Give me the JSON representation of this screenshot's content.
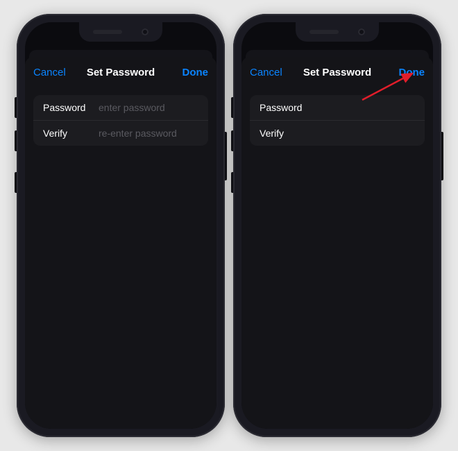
{
  "phones": {
    "left": {
      "nav": {
        "cancel": "Cancel",
        "title": "Set Password",
        "done": "Done"
      },
      "rows": {
        "password": {
          "label": "Password",
          "placeholder": "enter password",
          "value": ""
        },
        "verify": {
          "label": "Verify",
          "placeholder": "re-enter password",
          "value": ""
        }
      }
    },
    "right": {
      "nav": {
        "cancel": "Cancel",
        "title": "Set Password",
        "done": "Done"
      },
      "rows": {
        "password": {
          "label": "Password",
          "placeholder": "",
          "value": ""
        },
        "verify": {
          "label": "Verify",
          "placeholder": "",
          "value": ""
        }
      }
    }
  },
  "annotation": {
    "arrow_color": "#e11d2a"
  },
  "colors": {
    "accent": "#0a84ff",
    "sheet_bg": "#141418",
    "field_bg": "#1c1c20"
  }
}
